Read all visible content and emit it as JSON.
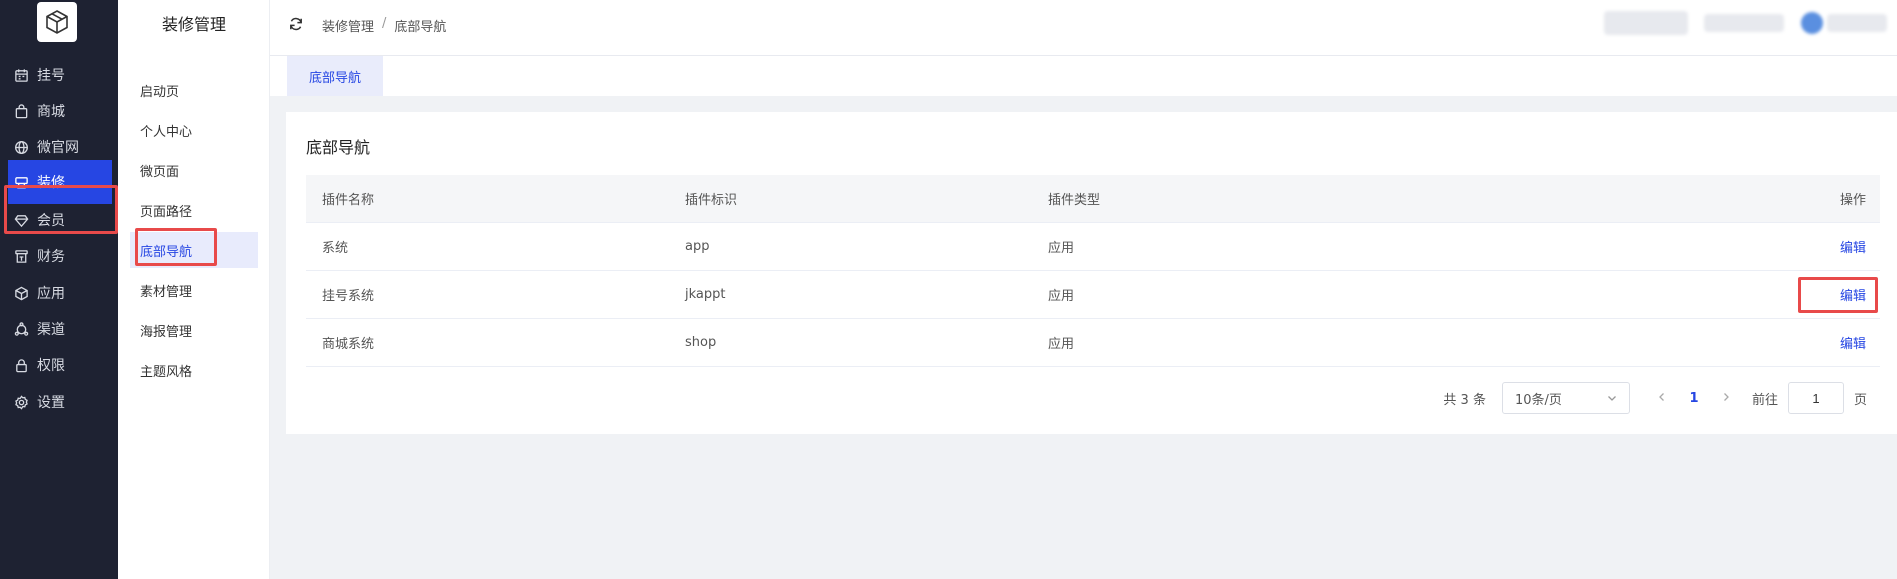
{
  "nav": {
    "items": [
      {
        "label": "挂号",
        "icon": "calendar-icon"
      },
      {
        "label": "商城",
        "icon": "shopping-bag-icon"
      },
      {
        "label": "微官网",
        "icon": "globe-icon"
      },
      {
        "label": "装修",
        "icon": "decoration-icon",
        "active": true
      },
      {
        "label": "会员",
        "icon": "diamond-icon"
      },
      {
        "label": "财务",
        "icon": "finance-icon"
      },
      {
        "label": "应用",
        "icon": "cube-icon"
      },
      {
        "label": "渠道",
        "icon": "channel-icon"
      },
      {
        "label": "权限",
        "icon": "lock-icon"
      },
      {
        "label": "设置",
        "icon": "gear-icon"
      }
    ]
  },
  "subnav": {
    "title": "装修管理",
    "items": [
      {
        "label": "启动页"
      },
      {
        "label": "个人中心"
      },
      {
        "label": "微页面"
      },
      {
        "label": "页面路径"
      },
      {
        "label": "底部导航",
        "active": true
      },
      {
        "label": "素材管理"
      },
      {
        "label": "海报管理"
      },
      {
        "label": "主题风格"
      }
    ]
  },
  "breadcrumb": {
    "parent": "装修管理",
    "separator": "/",
    "current": "底部导航"
  },
  "tab": {
    "label": "底部导航"
  },
  "card": {
    "title": "底部导航",
    "columns": [
      "插件名称",
      "插件标识",
      "插件类型",
      "操作"
    ],
    "rows": [
      {
        "name": "系统",
        "key": "app",
        "type": "应用",
        "action": "编辑"
      },
      {
        "name": "挂号系统",
        "key": "jkappt",
        "type": "应用",
        "action": "编辑"
      },
      {
        "name": "商城系统",
        "key": "shop",
        "type": "应用",
        "action": "编辑"
      }
    ]
  },
  "pagination": {
    "total": "共 3 条",
    "page_size": "10条/页",
    "current_page": "1",
    "goto_label": "前往",
    "goto_value": "1",
    "page_suffix": "页"
  },
  "colors": {
    "accent": "#2646e3",
    "nav_bg": "#1e2232",
    "highlight": "#e84a4a"
  }
}
